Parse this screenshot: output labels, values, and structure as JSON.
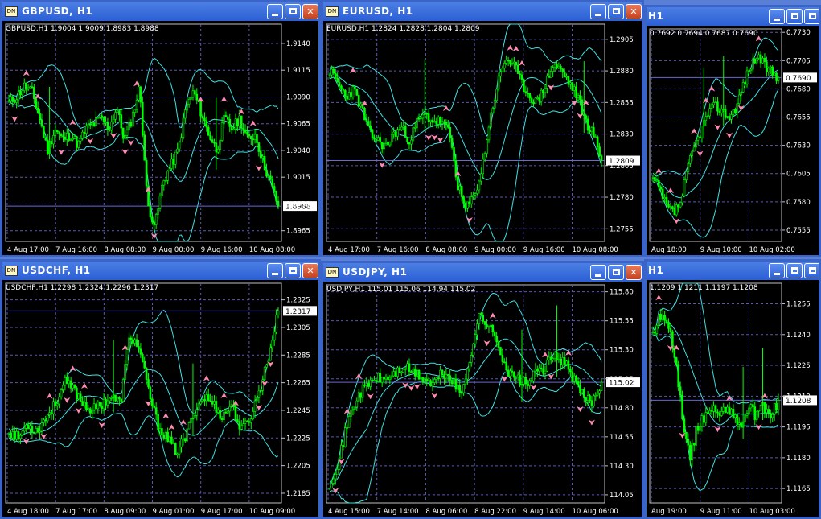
{
  "colors": {
    "candles": "#00ff00",
    "bands": "#40e0e0",
    "arrows": "#ff8ab0",
    "grid": "#5a5ab0",
    "price_line": "#6a6ad0"
  },
  "windows": [
    {
      "id": "gbpusd",
      "title": "GBPUSD, H1",
      "active": false,
      "info": "GBPUSD,H1  1.9004 1.9009 1.8983 1.8988",
      "price_label": "1.8988",
      "chart_data": {
        "type": "candlestick",
        "ylim": [
          1.8955,
          1.9158
        ],
        "y_ticks": [
          "1.9140",
          "1.9115",
          "1.9090",
          "1.9065",
          "1.9040",
          "1.9015",
          "1.8990",
          "1.8965"
        ],
        "y_values": [
          1.914,
          1.9115,
          1.909,
          1.9065,
          1.904,
          1.9015,
          1.899,
          1.8965
        ],
        "x_ticks": [
          "4 Aug 17:00",
          "7 Aug 16:00",
          "8 Aug 08:00",
          "9 Aug 00:00",
          "9 Aug 16:00",
          "10 Aug 08:00"
        ],
        "last": 1.8988,
        "path": [
          1.9085,
          1.909,
          1.91,
          1.9095,
          1.907,
          1.904,
          1.906,
          1.905,
          1.9055,
          1.9045,
          1.906,
          1.9065,
          1.907,
          1.906,
          1.908,
          1.905,
          1.907,
          1.91,
          1.899,
          1.897,
          1.901,
          1.9025,
          1.904,
          1.908,
          1.9095,
          1.9075,
          1.9055,
          1.904,
          1.907,
          1.906,
          1.907,
          1.905,
          1.9055,
          1.903,
          1.901,
          1.8988
        ],
        "seed": 11
      }
    },
    {
      "id": "eurusd",
      "title": "EURUSD, H1",
      "active": false,
      "info": "EURUSD,H1  1.2824 1.2828 1.2804 1.2809",
      "price_label": "1.2809",
      "chart_data": {
        "type": "candlestick",
        "ylim": [
          1.2745,
          1.2917
        ],
        "y_ticks": [
          "1.2905",
          "1.2880",
          "1.2855",
          "1.2830",
          "1.2805",
          "1.2780",
          "1.2755"
        ],
        "y_values": [
          1.2905,
          1.288,
          1.2855,
          1.283,
          1.2805,
          1.278,
          1.2755
        ],
        "x_ticks": [
          "4 Aug 17:00",
          "7 Aug 16:00",
          "8 Aug 08:00",
          "9 Aug 00:00",
          "9 Aug 16:00",
          "10 Aug 08:00"
        ],
        "last": 1.2809,
        "path": [
          1.288,
          1.287,
          1.286,
          1.2865,
          1.285,
          1.283,
          1.2825,
          1.282,
          1.283,
          1.2835,
          1.2825,
          1.284,
          1.2845,
          1.284,
          1.284,
          1.283,
          1.279,
          1.277,
          1.278,
          1.28,
          1.284,
          1.287,
          1.289,
          1.2885,
          1.287,
          1.286,
          1.2855,
          1.287,
          1.2885,
          1.288,
          1.287,
          1.286,
          1.284,
          1.283,
          1.2809
        ],
        "seed": 23
      }
    },
    {
      "id": "audusd",
      "title": "H1",
      "active": false,
      "info": "0.7692 0.7694 0.7687 0.7690",
      "price_label": "0.7690",
      "chart_data": {
        "type": "candlestick",
        "ylim": [
          0.7545,
          0.7733
        ],
        "y_ticks": [
          "0.7730",
          "0.7705",
          "0.7680",
          "0.7655",
          "0.7630",
          "0.7605",
          "0.7580",
          "0.7555"
        ],
        "y_values": [
          0.773,
          0.7705,
          0.768,
          0.7655,
          0.763,
          0.7605,
          0.758,
          0.7555
        ],
        "x_ticks": [
          "Aug 18:00",
          "9 Aug 10:00",
          "10 Aug 02:00"
        ],
        "last": 0.769,
        "path": [
          0.76,
          0.759,
          0.7575,
          0.757,
          0.758,
          0.761,
          0.763,
          0.7645,
          0.766,
          0.7665,
          0.766,
          0.7655,
          0.7665,
          0.7685,
          0.77,
          0.771,
          0.77,
          0.7695,
          0.769
        ],
        "seed": 37
      }
    },
    {
      "id": "usdchf",
      "title": "USDCHF, H1",
      "active": false,
      "info": "USDCHF,H1  1.2298 1.2324 1.2296 1.2317",
      "price_label": "1.2317",
      "chart_data": {
        "type": "candlestick",
        "ylim": [
          1.2178,
          1.2337
        ],
        "y_ticks": [
          "1.2325",
          "1.2305",
          "1.2285",
          "1.2265",
          "1.2245",
          "1.2225",
          "1.2205",
          "1.2185"
        ],
        "y_values": [
          1.2325,
          1.2305,
          1.2285,
          1.2265,
          1.2245,
          1.2225,
          1.2205,
          1.2185
        ],
        "x_ticks": [
          "4 Aug 18:00",
          "7 Aug 17:00",
          "8 Aug 09:00",
          "9 Aug 01:00",
          "9 Aug 17:00",
          "10 Aug 09:00"
        ],
        "last": 1.2317,
        "path": [
          1.223,
          1.2225,
          1.2235,
          1.223,
          1.224,
          1.225,
          1.2265,
          1.226,
          1.225,
          1.2245,
          1.225,
          1.2255,
          1.225,
          1.23,
          1.229,
          1.226,
          1.2235,
          1.2225,
          1.2215,
          1.2225,
          1.2245,
          1.2255,
          1.225,
          1.224,
          1.225,
          1.223,
          1.224,
          1.226,
          1.2285,
          1.2317
        ],
        "seed": 53
      }
    },
    {
      "id": "usdjpy",
      "title": "USDJPY, H1",
      "active": false,
      "info": "USDJPY,H1  115.01 115.06 114.94 115.02",
      "price_label": "115.02",
      "chart_data": {
        "type": "candlestick",
        "ylim": [
          113.98,
          115.86
        ],
        "y_ticks": [
          "115.80",
          "115.55",
          "115.30",
          "115.05",
          "114.80",
          "114.55",
          "114.30",
          "114.05"
        ],
        "y_values": [
          115.8,
          115.55,
          115.3,
          115.05,
          114.8,
          114.55,
          114.3,
          114.05
        ],
        "x_ticks": [
          "4 Aug 15:00",
          "7 Aug 14:00",
          "8 Aug 06:00",
          "8 Aug 22:00",
          "9 Aug 14:00",
          "10 Aug 06:00"
        ],
        "last": 115.02,
        "path": [
          114.15,
          114.35,
          114.7,
          114.9,
          115.0,
          115.05,
          115.05,
          115.1,
          115.15,
          115.1,
          115.05,
          115.0,
          115.1,
          115.05,
          114.9,
          115.25,
          115.6,
          115.5,
          115.35,
          115.1,
          115.05,
          115.0,
          115.1,
          115.15,
          115.25,
          115.2,
          115.05,
          114.9,
          114.85,
          115.02
        ],
        "seed": 71
      }
    },
    {
      "id": "gbpchf",
      "title": "H1",
      "active": false,
      "info": "1.1209 1.1211 1.1197 1.1208",
      "price_label": "1.1208",
      "chart_data": {
        "type": "candlestick",
        "ylim": [
          1.1158,
          1.1265
        ],
        "y_ticks": [
          "1.1255",
          "1.1240",
          "1.1225",
          "1.1210",
          "1.1195",
          "1.1180",
          "1.1165"
        ],
        "y_values": [
          1.1255,
          1.124,
          1.1225,
          1.121,
          1.1195,
          1.118,
          1.1165
        ],
        "x_ticks": [
          "Aug 19:00",
          "9 Aug 11:00",
          "10 Aug 03:00"
        ],
        "last": 1.1208,
        "path": [
          1.124,
          1.125,
          1.1245,
          1.123,
          1.12,
          1.118,
          1.1195,
          1.12,
          1.1205,
          1.12,
          1.1205,
          1.12,
          1.1195,
          1.1205,
          1.12,
          1.1205,
          1.12,
          1.1208
        ],
        "seed": 89
      }
    }
  ]
}
